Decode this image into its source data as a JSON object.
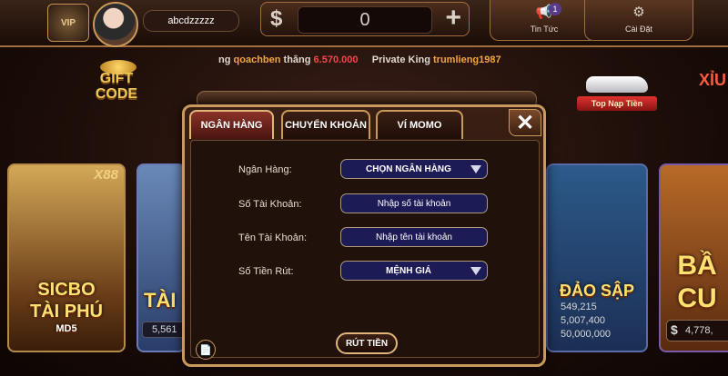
{
  "header": {
    "username": "abcdzzzzz",
    "balance": "0",
    "currency_symbol": "$",
    "news": {
      "label": "Tin Tức",
      "badge": "1"
    },
    "settings": {
      "label": "Cài Đặt"
    }
  },
  "ticker": {
    "prefix": "ng",
    "user1": "qoachben",
    "verb": "thắng",
    "amount": "6.570.000",
    "king_label": "Private King",
    "user2": "trumlieng1987"
  },
  "promos": {
    "gift_code": "GIFT CODE",
    "top_nap": "Top Nạp Tiền",
    "xiu": "XỈU"
  },
  "games": {
    "sicbo": {
      "tag": "X88",
      "title_line1": "SICBO",
      "title_line2": "TÀI PHÚ",
      "title_line3": "MD5"
    },
    "tai": {
      "title": "TÀI",
      "jackpot": "5,561"
    },
    "daosap": {
      "title": "ĐẢO SẬP",
      "jackpots": [
        "549,215",
        "5,007,400",
        "50,000,000"
      ]
    },
    "baucua": {
      "title_line1": "BẦ",
      "title_line2": "CU",
      "jackpot": "4,778,",
      "currency": "$"
    }
  },
  "modal": {
    "tabs": [
      "NGÂN HÀNG",
      "CHUYỂN KHOẢN",
      "VÍ MOMO"
    ],
    "active_tab": "NGÂN HÀNG",
    "close": "✕",
    "fields": {
      "bank": {
        "label": "Ngân Hàng:",
        "value": "CHỌN NGÂN HÀNG"
      },
      "account_no": {
        "label": "Số Tài Khoản:",
        "placeholder": "Nhập số tài khoản"
      },
      "account_name": {
        "label": "Tên Tài Khoản:",
        "placeholder": "Nhập tên tài khoản"
      },
      "amount": {
        "label": "Số Tiền Rút:",
        "value": "MỆNH GIÁ"
      }
    },
    "submit": "RÚT TIỀN",
    "history_icon": "📄"
  },
  "colors": {
    "accent_gold": "#c99a5b",
    "field_bg": "#1d1b55",
    "active_tab": "#8a3228",
    "ticker_name": "#f0a640",
    "ticker_amount": "#f04848"
  }
}
